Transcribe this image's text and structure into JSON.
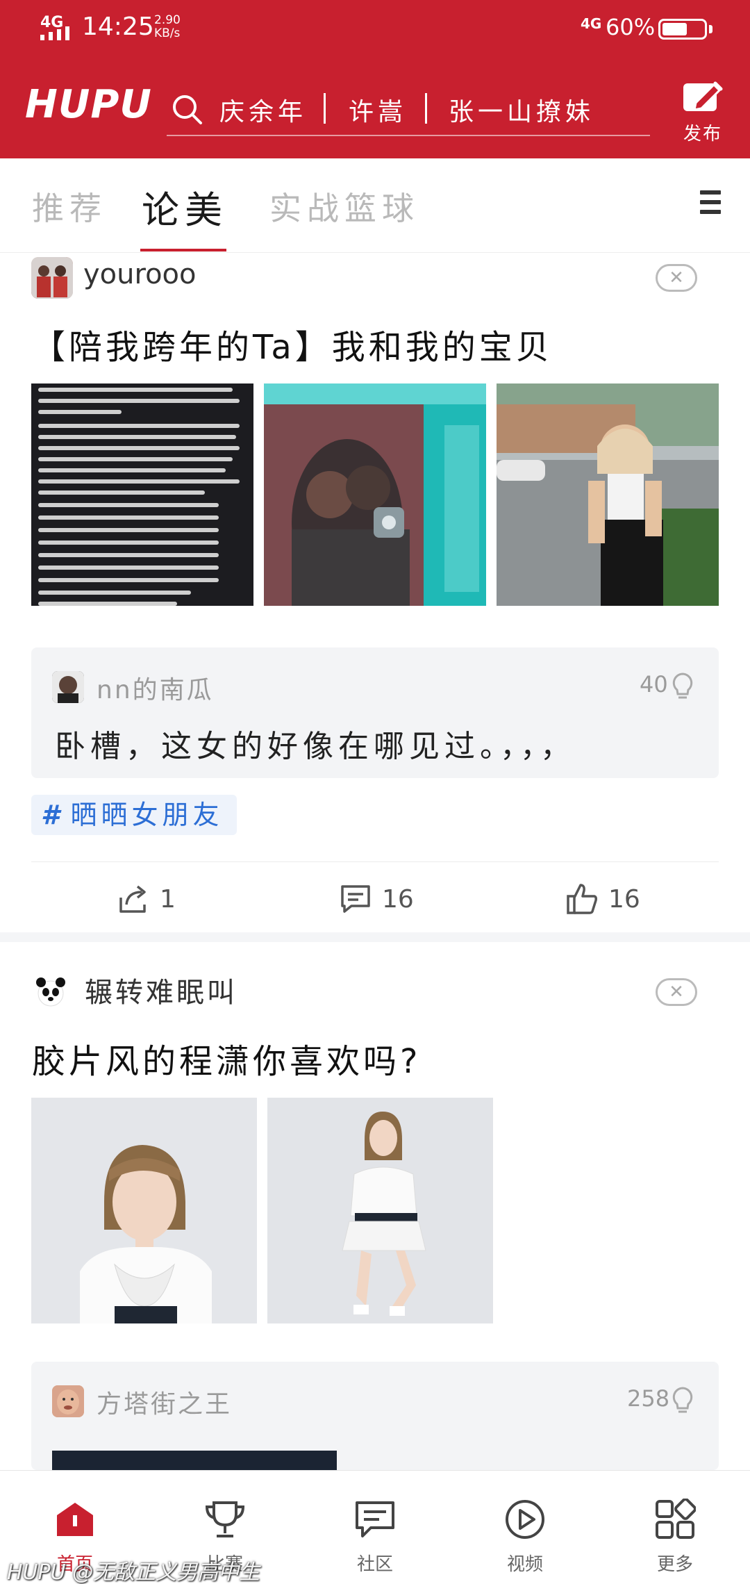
{
  "status_bar": {
    "signal": "4G",
    "time": "14:25",
    "speed_value": "2.90",
    "speed_unit": "KB/s",
    "network": "4G",
    "battery_pct": "60%",
    "battery_level": 0.6
  },
  "header": {
    "logo": "HUPU",
    "hot_searches": [
      "庆余年",
      "许嵩",
      "张一山撩妹"
    ],
    "publish_label": "发布",
    "accent_color": "#c8202f"
  },
  "tabs": [
    {
      "label": "推荐"
    },
    {
      "label": "论美"
    },
    {
      "label": "实战篮球"
    }
  ],
  "posts": [
    {
      "author": "yourooo",
      "close_glyph": "✕",
      "title": "【陪我跨年的Ta】我和我的宝贝",
      "hot_comment": {
        "user": "nn的南瓜",
        "likes": "40",
        "text": "卧槽，这女的好像在哪见过。，，，"
      },
      "tag": "晒晒女朋友",
      "actions": {
        "share": "1",
        "comments": "16",
        "likes": "16"
      }
    },
    {
      "author": "辗转难眠叫",
      "close_glyph": "✕",
      "title": "胶片风的程潇你喜欢吗?",
      "hot_comment": {
        "user": "方塔街之王",
        "likes": "258"
      }
    }
  ],
  "bottom_nav": [
    {
      "label": "首页",
      "icon": "home-icon"
    },
    {
      "label": "比赛",
      "icon": "trophy-icon"
    },
    {
      "label": "社区",
      "icon": "chat-icon"
    },
    {
      "label": "视频",
      "icon": "play-icon"
    },
    {
      "label": "更多",
      "icon": "grid-icon"
    }
  ],
  "watermark": "HUPU @无敌正义男高中生"
}
